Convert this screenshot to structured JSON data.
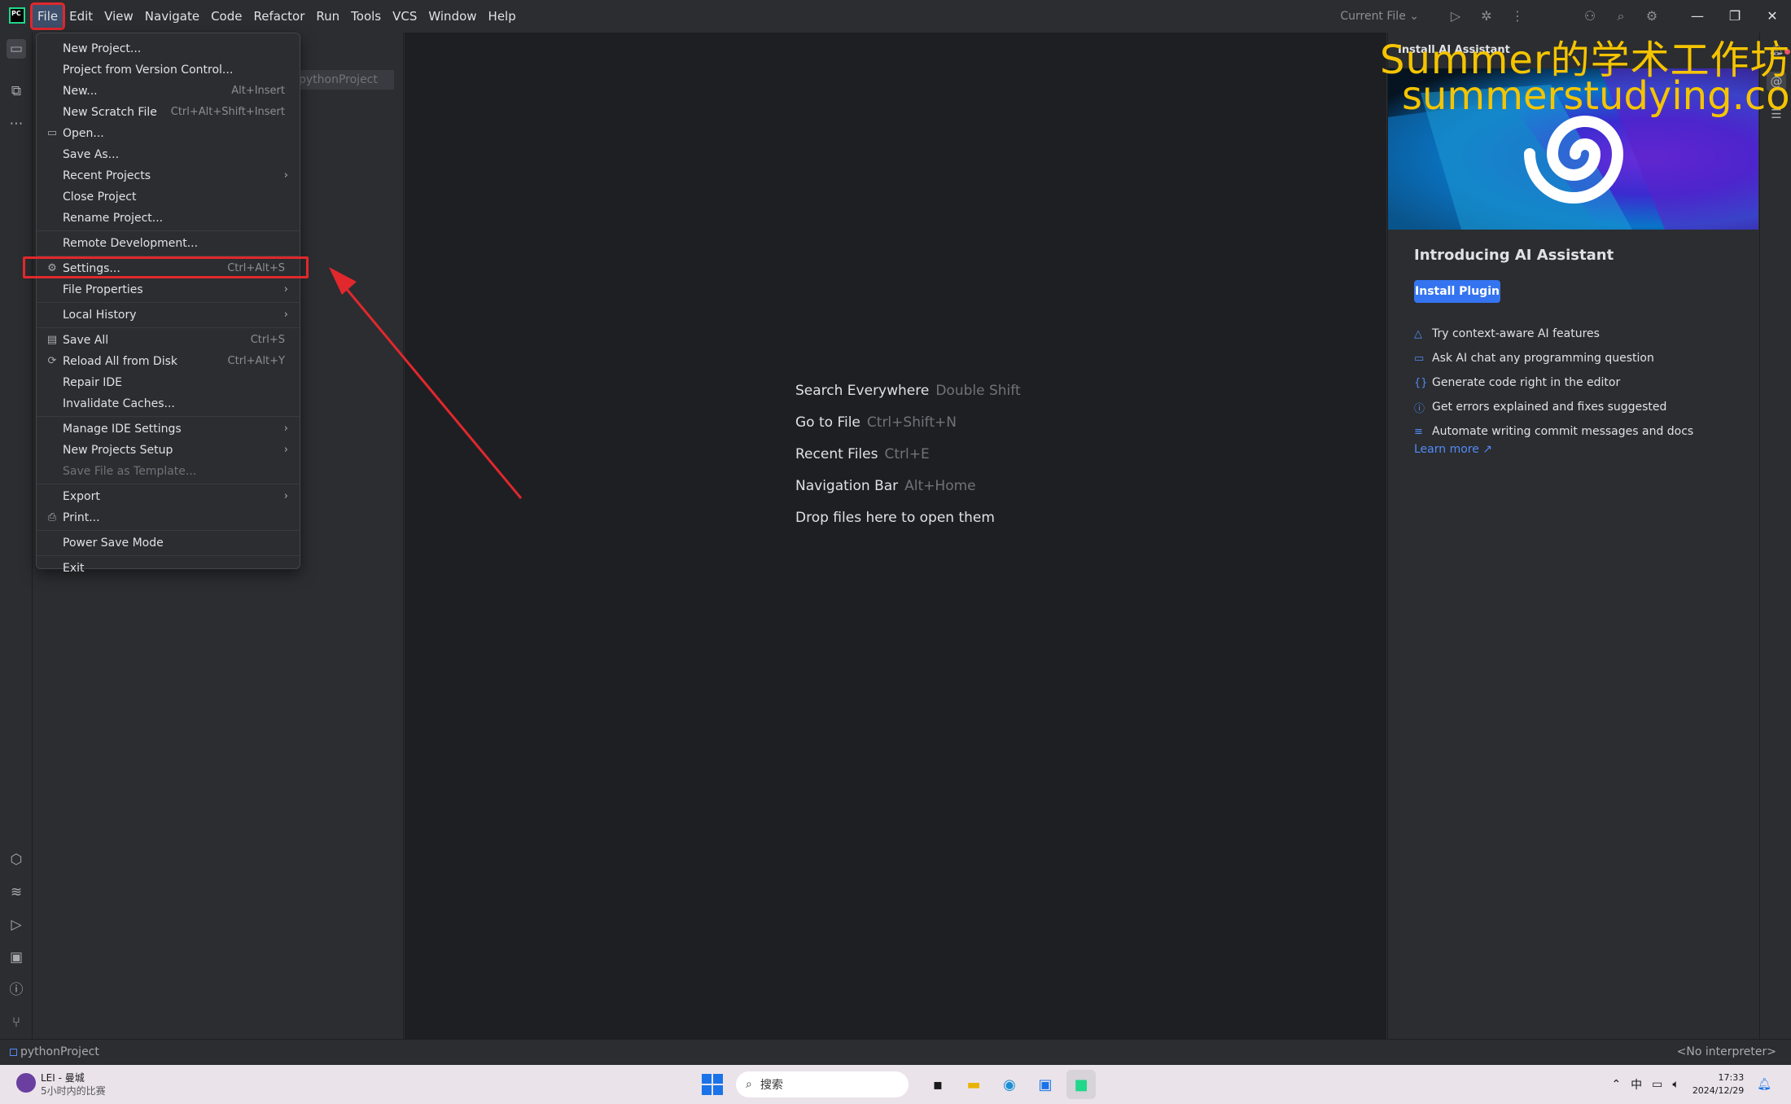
{
  "menubar": {
    "items": [
      "File",
      "Edit",
      "View",
      "Navigate",
      "Code",
      "Refactor",
      "Run",
      "Tools",
      "VCS",
      "Window",
      "Help"
    ]
  },
  "titlebar": {
    "run_config": "Current File",
    "app_logo": "PC"
  },
  "project_panel": {
    "project_chip": "pythonProject"
  },
  "file_menu": {
    "items": [
      {
        "label": "New Project...",
        "shortcut": "",
        "icon": "",
        "submenu": false
      },
      {
        "label": "Project from Version Control...",
        "shortcut": "",
        "icon": "",
        "submenu": false
      },
      {
        "label": "New...",
        "shortcut": "Alt+Insert",
        "icon": "",
        "submenu": false
      },
      {
        "label": "New Scratch File",
        "shortcut": "Ctrl+Alt+Shift+Insert",
        "icon": "",
        "submenu": false
      },
      {
        "label": "Open...",
        "shortcut": "",
        "icon": "folder-icon",
        "submenu": false
      },
      {
        "label": "Save As...",
        "shortcut": "",
        "icon": "",
        "submenu": false
      },
      {
        "label": "Recent Projects",
        "shortcut": "",
        "icon": "",
        "submenu": true
      },
      {
        "label": "Close Project",
        "shortcut": "",
        "icon": "",
        "submenu": false
      },
      {
        "label": "Rename Project...",
        "shortcut": "",
        "icon": "",
        "submenu": false
      },
      {
        "label": "Remote Development...",
        "shortcut": "",
        "icon": "",
        "submenu": false
      },
      {
        "label": "Settings...",
        "shortcut": "Ctrl+Alt+S",
        "icon": "gear-icon",
        "submenu": false
      },
      {
        "label": "File Properties",
        "shortcut": "",
        "icon": "",
        "submenu": true
      },
      {
        "label": "Local History",
        "shortcut": "",
        "icon": "",
        "submenu": true
      },
      {
        "label": "Save All",
        "shortcut": "Ctrl+S",
        "icon": "save-icon",
        "submenu": false
      },
      {
        "label": "Reload All from Disk",
        "shortcut": "Ctrl+Alt+Y",
        "icon": "reload-icon",
        "submenu": false
      },
      {
        "label": "Repair IDE",
        "shortcut": "",
        "icon": "",
        "submenu": false
      },
      {
        "label": "Invalidate Caches...",
        "shortcut": "",
        "icon": "",
        "submenu": false
      },
      {
        "label": "Manage IDE Settings",
        "shortcut": "",
        "icon": "",
        "submenu": true
      },
      {
        "label": "New Projects Setup",
        "shortcut": "",
        "icon": "",
        "submenu": true
      },
      {
        "label": "Save File as Template...",
        "shortcut": "",
        "icon": "",
        "submenu": false,
        "disabled": true
      },
      {
        "label": "Export",
        "shortcut": "",
        "icon": "",
        "submenu": true
      },
      {
        "label": "Print...",
        "shortcut": "",
        "icon": "print-icon",
        "submenu": false
      },
      {
        "label": "Power Save Mode",
        "shortcut": "",
        "icon": "",
        "submenu": false
      },
      {
        "label": "Exit",
        "shortcut": "",
        "icon": "",
        "submenu": false
      }
    ]
  },
  "editor": {
    "hints": [
      {
        "label": "Search Everywhere",
        "shortcut": "Double Shift"
      },
      {
        "label": "Go to File",
        "shortcut": "Ctrl+Shift+N"
      },
      {
        "label": "Recent Files",
        "shortcut": "Ctrl+E"
      },
      {
        "label": "Navigation Bar",
        "shortcut": "Alt+Home"
      },
      {
        "label": "Drop files here to open them",
        "shortcut": ""
      }
    ]
  },
  "ai_panel": {
    "header": "Install AI Assistant",
    "title": "Introducing AI Assistant",
    "install_button": "Install Plugin",
    "features": [
      "Try context-aware AI features",
      "Ask AI chat any programming question",
      "Generate code right in the editor",
      "Get errors explained and fixes suggested",
      "Automate writing commit messages and docs"
    ],
    "learn_more": "Learn more ↗"
  },
  "watermark": {
    "line1": "Summer的学术工作坊",
    "line2": "summerstudying.com"
  },
  "statusbar": {
    "project": "pythonProject",
    "interpreter": "<No interpreter>"
  },
  "taskbar": {
    "weather_title": "LEI - 曼城",
    "weather_sub": "5小时内的比赛",
    "search_placeholder": "搜索",
    "tray_ime": "中",
    "time": "17:33",
    "date": "2024/12/29"
  },
  "colors": {
    "accent": "#3574f0",
    "highlight": "#e0282d",
    "watermark": "#f5c400",
    "editor_bg": "#1e1f22",
    "panel_bg": "#2b2d30"
  }
}
